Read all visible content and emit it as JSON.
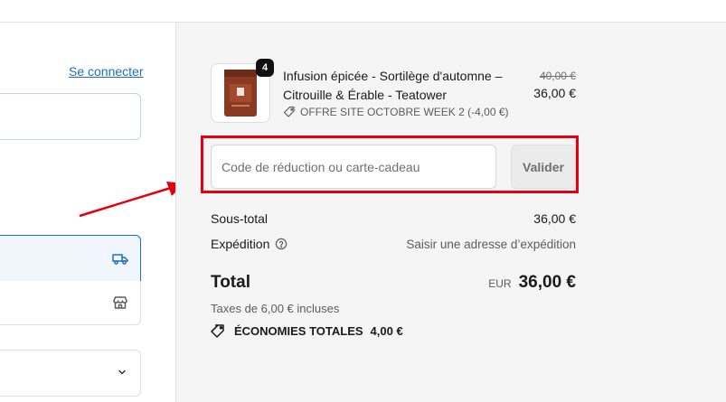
{
  "header": {
    "login_link": "Se connecter"
  },
  "product": {
    "name": "Infusion épicée - Sortilège d'automne – Citrouille & Érable - Teatower",
    "quantity": "4",
    "original_price": "40,00 €",
    "price": "36,00 €",
    "discount_label": "OFFRE SITE OCTOBRE WEEK 2 (-4,00 €)"
  },
  "discount": {
    "placeholder": "Code de réduction ou carte-cadeau",
    "apply_label": "Valider"
  },
  "summary": {
    "subtotal_label": "Sous-total",
    "subtotal_value": "36,00 €",
    "shipping_label": "Expédition",
    "shipping_value": "Saisir une adresse d’expédition",
    "total_label": "Total",
    "currency": "EUR",
    "total_value": "36,00 €",
    "taxes_note": "Taxes de 6,00 € incluses",
    "savings_label": "ÉCONOMIES TOTALES",
    "savings_value": "4,00 €"
  },
  "colors": {
    "link": "#1f6fbd",
    "highlight": "#e3000f",
    "panel_bg": "#f5f5f5"
  },
  "icons": [
    "delivery-truck-icon",
    "store-icon",
    "chevron-down-icon",
    "tag-icon",
    "help-circle-icon",
    "savings-tag-icon",
    "annotation-arrow"
  ]
}
